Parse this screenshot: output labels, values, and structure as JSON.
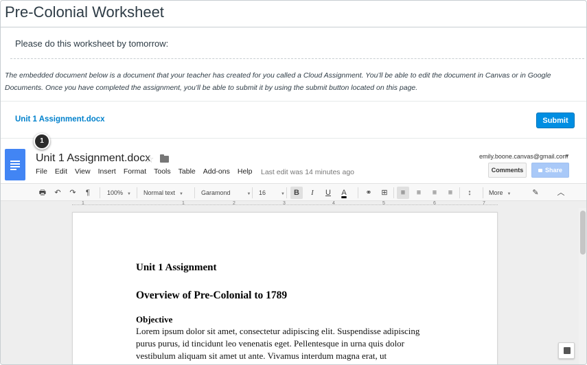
{
  "page": {
    "title": "Pre-Colonial Worksheet",
    "intro": "Please do this worksheet by tomorrow:",
    "notice": "The embedded document below is a document that your teacher has created for you called a Cloud Assignment. You’ll be able to edit the document in Canvas or in Google Documents. Once you have completed the assignment, you’ll be able to submit it by using the submit button located on this page.",
    "file_link": "Unit 1 Assignment.docx",
    "submit_label": "Submit",
    "accent_color": "#008ee2"
  },
  "callout": {
    "number": "1"
  },
  "gdoc": {
    "title": "Unit 1 Assignment.docx",
    "icons": {
      "star": "star-icon",
      "folder": "folder-icon",
      "logo": "google-docs-logo"
    },
    "menu": [
      "File",
      "Edit",
      "View",
      "Insert",
      "Format",
      "Tools",
      "Table",
      "Add-ons",
      "Help"
    ],
    "last_edit": "Last edit was 14 minutes ago",
    "account": "emily.boone.canvas@gmail.com",
    "comments_label": "Comments",
    "share_label": "Share",
    "toolbar": {
      "zoom": "100%",
      "style": "Normal text",
      "font": "Garamond",
      "size": "16",
      "bold": "B",
      "italic": "I",
      "underline": "U",
      "text_color": "A",
      "more": "More",
      "print_icon": "🖶",
      "undo_icon": "↶",
      "redo_icon": "↷",
      "paint_icon": "¶",
      "link_icon": "⚭",
      "comment_icon": "⊞",
      "align_left_icon": "≡",
      "align_center_icon": "≡",
      "align_right_icon": "≡",
      "justify_icon": "≡",
      "line_spacing_icon": "↕",
      "edit_mode_icon": "✎",
      "collapse_icon": "︿"
    },
    "ruler": [
      "1",
      "1",
      "2",
      "3",
      "4",
      "5",
      "6",
      "7"
    ],
    "document": {
      "heading": "Unit 1 Assignment",
      "subheading": "Overview of Pre-Colonial to 1789",
      "section": "Objective",
      "body_lines": [
        "Lorem ipsum dolor sit amet, consectetur adipiscing elit. Suspendisse adipiscing",
        "purus purus, id tincidunt leo venenatis eget. Pellentesque in urna quis dolor",
        "vestibulum aliquam sit amet ut ante. Vivamus interdum magna erat, ut"
      ]
    }
  }
}
